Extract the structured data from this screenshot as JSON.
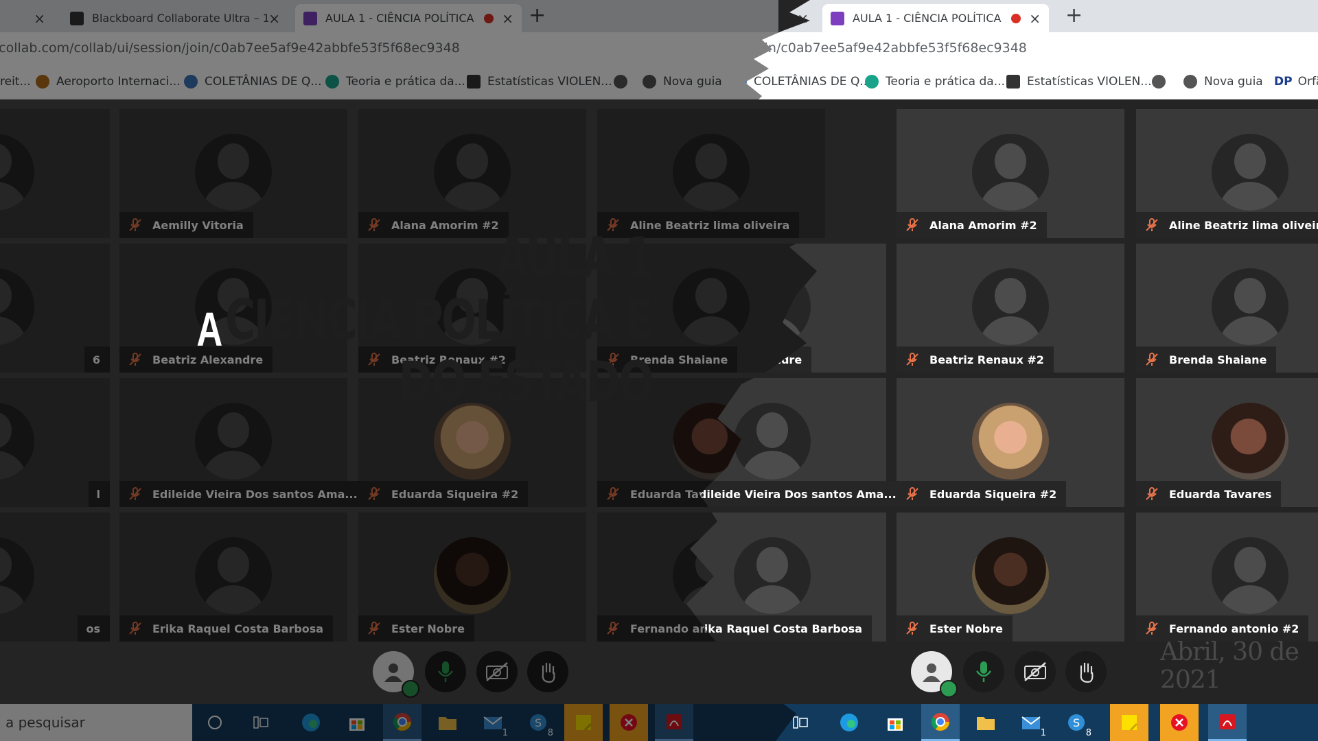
{
  "tabs": [
    {
      "title": "",
      "close_icon": "×"
    },
    {
      "title": "Blackboard Collaborate Ultra – 1...",
      "favicon": "bb-icon",
      "close_icon": "×"
    },
    {
      "title": "AULA 1 - CIÊNCIA POLÍTICA",
      "favicon": "collab-icon",
      "recording": true,
      "close_icon": "×"
    }
  ],
  "new_tab": "+",
  "address_bar": {
    "left_text": "bbcollab.com/collab/ui/session/join/c0ab7ee5af9e42abbfe53f5f68ec9348",
    "right_text": "session/join/c0ab7ee5af9e42abbfe53f5f68ec9348"
  },
  "bookmarks": [
    {
      "label": "reit...",
      "icon": "none"
    },
    {
      "label": "Aeroporto Internaci...",
      "icon": "plane-icon"
    },
    {
      "label": "COLETÂNIAS DE Q...",
      "icon": "wordpress-icon"
    },
    {
      "label": "Teoria e prática da...",
      "icon": "site-icon"
    },
    {
      "label": "Estatísticas VIOLEN...",
      "icon": "chart-icon"
    },
    {
      "label": "",
      "icon": "globe-icon"
    },
    {
      "label": "Nova guia",
      "icon": "globe-icon"
    },
    {
      "label": "Orfã",
      "icon": "dp-icon"
    }
  ],
  "bookmark_dp": "DP",
  "participants": [
    {
      "name": "Aemilly Vitoria",
      "avatar": "default"
    },
    {
      "name": "Alana Amorim #2",
      "avatar": "default"
    },
    {
      "name": "Aline Beatriz lima oliveira",
      "avatar": "default"
    },
    {
      "name": "Beatriz Alexandre",
      "avatar": "default"
    },
    {
      "name": "Beatriz Renaux #2",
      "avatar": "default"
    },
    {
      "name": "Brenda Shaiane",
      "avatar": "default"
    },
    {
      "name": "Edileide Vieira Dos santos Ama...",
      "avatar": "default"
    },
    {
      "name": "Eduarda Siqueira #2",
      "avatar": "photo"
    },
    {
      "name": "Eduarda Tavares",
      "avatar": "photo"
    },
    {
      "name": "Erika Raquel Costa Barbosa",
      "avatar": "default"
    },
    {
      "name": "Ester Nobre",
      "avatar": "photo"
    },
    {
      "name": "Fernando antonio #2",
      "avatar": "default"
    }
  ],
  "edge_fragments": [
    "6",
    "l",
    "os"
  ],
  "controls": [
    {
      "name": "my-status-button",
      "icon": "user-icon"
    },
    {
      "name": "microphone-button",
      "icon": "microphone-icon"
    },
    {
      "name": "camera-button",
      "icon": "camera-off-icon"
    },
    {
      "name": "raise-hand-button",
      "icon": "hand-icon"
    }
  ],
  "overlay": {
    "title_line1": "AULA 1",
    "title_line2": "CIÊNCIA POLÍTICA E DO ESTADO",
    "letter": "A",
    "date": "Abril, 30 de 2021"
  },
  "taskbar": {
    "search_placeholder": "a pesquisar",
    "mail_badge": "1",
    "skype_badge": "8"
  },
  "colors": {
    "accent_purple": "#7e3fbf",
    "record_red": "#d93025",
    "mic_green": "#2d9c53",
    "taskbar_blue": "#123a5c"
  }
}
